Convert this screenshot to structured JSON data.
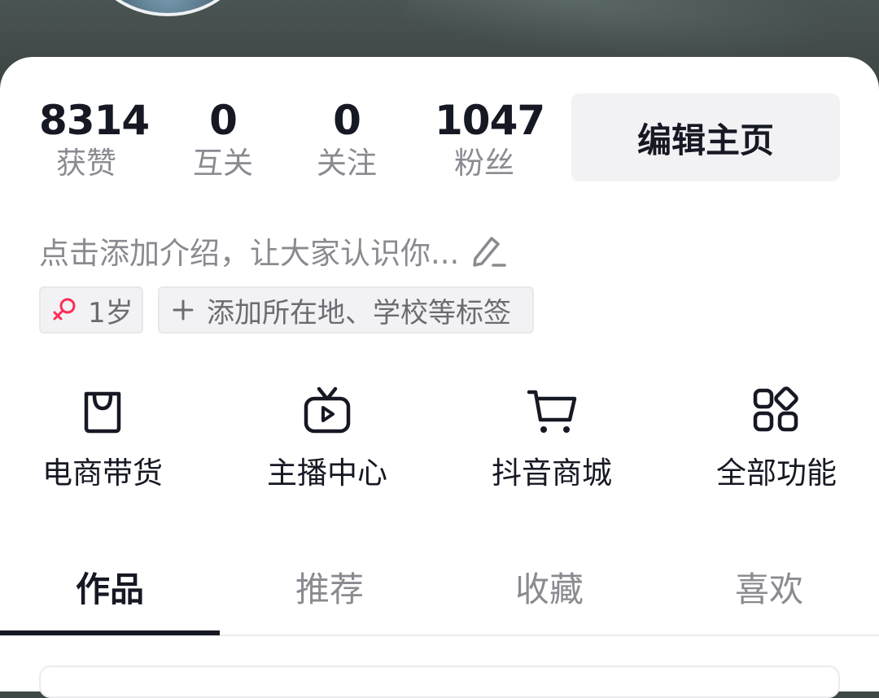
{
  "stats": [
    {
      "value": "8314",
      "label": "获赞"
    },
    {
      "value": "0",
      "label": "互关"
    },
    {
      "value": "0",
      "label": "关注"
    },
    {
      "value": "1047",
      "label": "粉丝"
    }
  ],
  "edit_profile_label": "编辑主页",
  "bio_placeholder": "点击添加介绍，让大家认识你...",
  "tags": {
    "age": "1岁",
    "add": "添加所在地、学校等标签"
  },
  "features": [
    {
      "label": "电商带货",
      "icon": "shopping-bag-icon"
    },
    {
      "label": "主播中心",
      "icon": "tv-play-icon"
    },
    {
      "label": "抖音商城",
      "icon": "shopping-cart-icon"
    },
    {
      "label": "全部功能",
      "icon": "apps-grid-icon"
    }
  ],
  "tabs": [
    {
      "label": "作品",
      "active": true
    },
    {
      "label": "推荐",
      "active": false
    },
    {
      "label": "收藏",
      "active": false
    },
    {
      "label": "喜欢",
      "active": false
    }
  ],
  "colors": {
    "text_primary": "#161823",
    "text_secondary": "#8a8b91",
    "female_icon": "#fe2c55",
    "button_bg": "#f2f2f4"
  }
}
